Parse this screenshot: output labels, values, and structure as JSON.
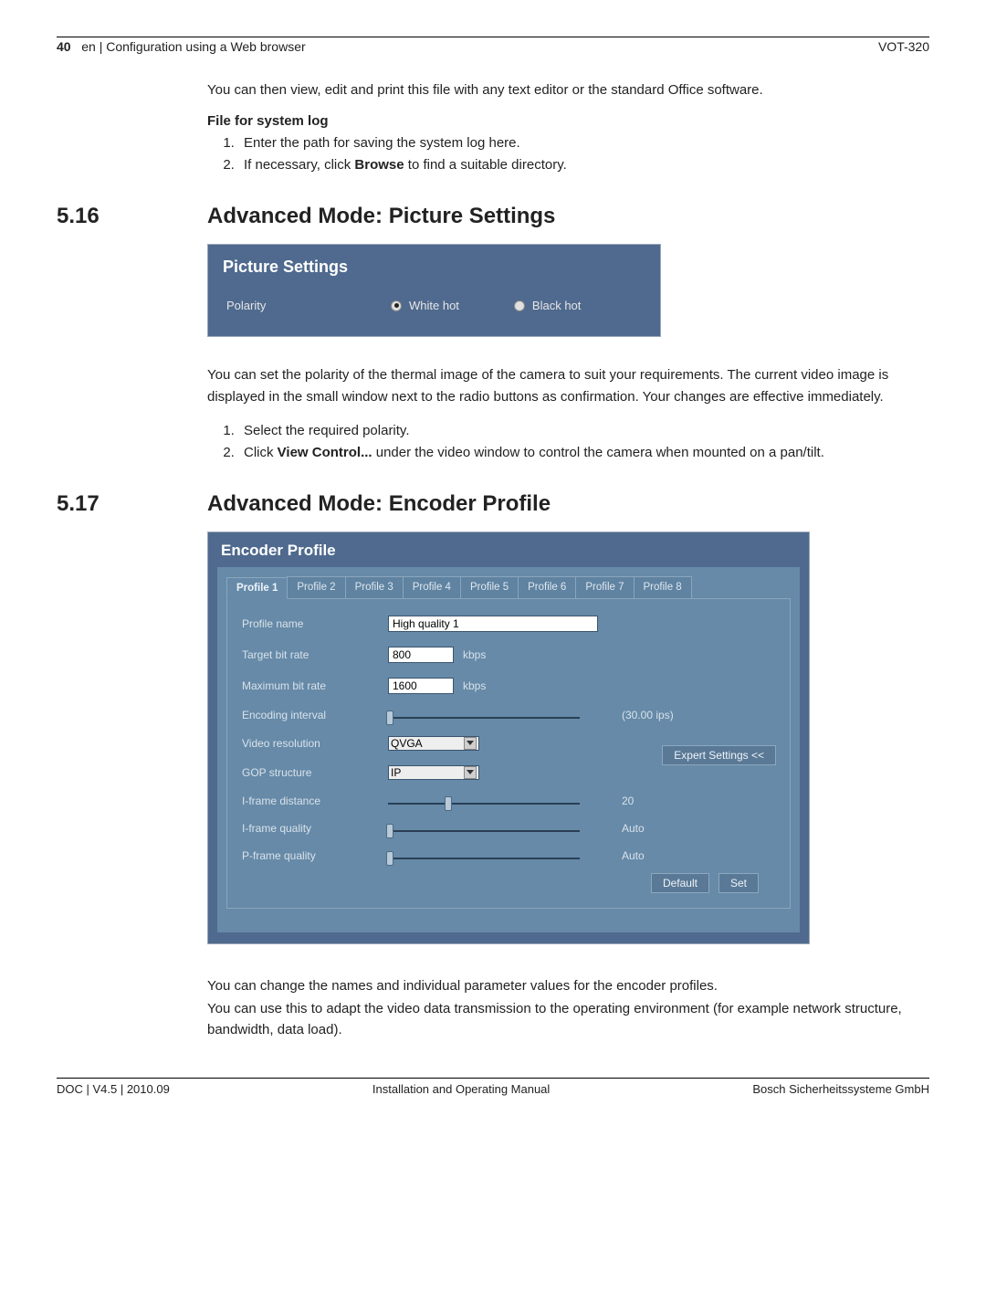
{
  "header": {
    "page_num": "40",
    "path": "en | Configuration using a Web browser",
    "model": "VOT-320"
  },
  "body": {
    "intro_line": "You can then view, edit and print this file with any text editor or the standard Office software.",
    "file_log_head": "File for system log",
    "file_log_steps": [
      "Enter the path for saving the system log here.",
      "If necessary, click Browse to find a suitable directory."
    ],
    "browse_bold": "Browse"
  },
  "sec516": {
    "num": "5.16",
    "title": "Advanced Mode: Picture Settings",
    "panel_title": "Picture Settings",
    "polarity_label": "Polarity",
    "white_hot": "White hot",
    "black_hot": "Black hot",
    "para": "You can set the polarity of the thermal image of the camera to suit your requirements. The current video image is displayed in the small window next to the radio buttons as confirmation. Your changes are effective immediately.",
    "steps": [
      "Select the required polarity.",
      "Click View Control... under the video window to control the camera when mounted on a pan/tilt."
    ],
    "view_control_bold": "View Control..."
  },
  "sec517": {
    "num": "5.17",
    "title": "Advanced Mode: Encoder Profile",
    "panel_title": "Encoder Profile",
    "tabs": [
      "Profile 1",
      "Profile 2",
      "Profile 3",
      "Profile 4",
      "Profile 5",
      "Profile 6",
      "Profile 7",
      "Profile 8"
    ],
    "form": {
      "profile_name_label": "Profile name",
      "profile_name_value": "High quality 1",
      "target_bitrate_label": "Target bit rate",
      "target_bitrate_value": "800",
      "max_bitrate_label": "Maximum bit rate",
      "max_bitrate_value": "1600",
      "kbps": "kbps",
      "enc_interval_label": "Encoding interval",
      "enc_interval_value": "(30.00 ips)",
      "video_res_label": "Video resolution",
      "video_res_value": "QVGA",
      "expert_btn": "Expert Settings <<",
      "gop_label": "GOP structure",
      "gop_value": "IP",
      "iframe_dist_label": "I-frame distance",
      "iframe_dist_value": "20",
      "iframe_q_label": "I-frame quality",
      "iframe_q_value": "Auto",
      "pframe_q_label": "P-frame quality",
      "pframe_q_value": "Auto",
      "default_btn": "Default",
      "set_btn": "Set"
    },
    "para1": "You can change the names and individual parameter values for the encoder profiles.",
    "para2": "You can use this to adapt the video data transmission to the operating environment (for example network structure, bandwidth, data load)."
  },
  "footer": {
    "left": "DOC | V4.5 | 2010.09",
    "center": "Installation and Operating Manual",
    "right": "Bosch Sicherheitssysteme GmbH"
  },
  "chart_data": {
    "type": "table",
    "title": "Encoder Profile — Profile 1 parameters",
    "rows": [
      {
        "parameter": "Profile name",
        "value": "High quality 1"
      },
      {
        "parameter": "Target bit rate",
        "value": 800,
        "unit": "kbps"
      },
      {
        "parameter": "Maximum bit rate",
        "value": 1600,
        "unit": "kbps"
      },
      {
        "parameter": "Encoding interval",
        "value": 30.0,
        "unit": "ips"
      },
      {
        "parameter": "Video resolution",
        "value": "QVGA"
      },
      {
        "parameter": "GOP structure",
        "value": "IP"
      },
      {
        "parameter": "I-frame distance",
        "value": 20
      },
      {
        "parameter": "I-frame quality",
        "value": "Auto"
      },
      {
        "parameter": "P-frame quality",
        "value": "Auto"
      }
    ]
  }
}
